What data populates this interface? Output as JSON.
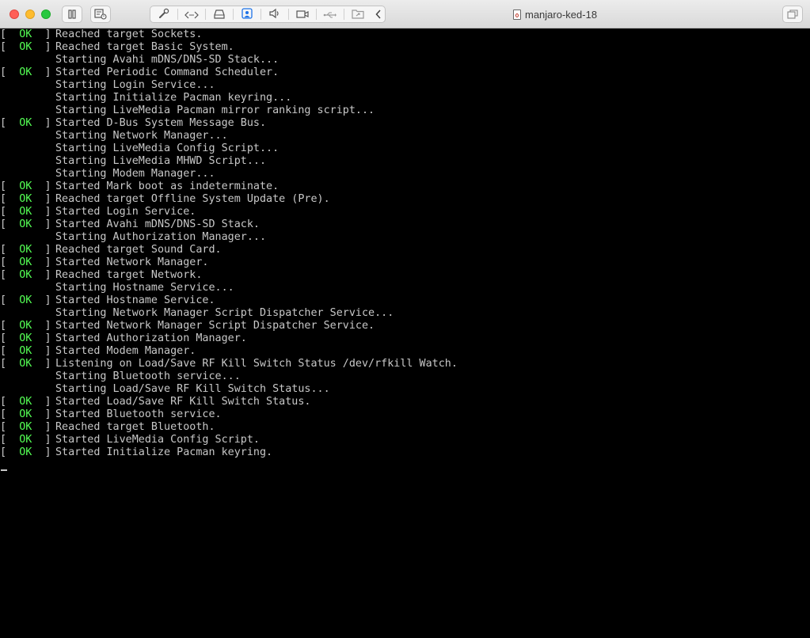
{
  "window": {
    "title": "manjaro-ked-18",
    "toolbar": {
      "pause": "pause-icon",
      "snapshot": "snapshot-icon",
      "settings": "wrench-icon",
      "code": "code-icon",
      "drive": "hard-disk-icon",
      "camera_user": "webcam-user-icon",
      "sound": "speaker-icon",
      "video": "video-camera-icon",
      "usb": "usb-icon",
      "shared_folder": "shared-folder-icon",
      "collapse": "chevron-left-icon",
      "fullscreen": "fullscreen-icon"
    }
  },
  "console": {
    "ok_left": "[",
    "ok_text": "OK",
    "ok_right": "]",
    "lines": [
      {
        "status": "ok",
        "text": "Reached target Sockets."
      },
      {
        "status": "ok",
        "text": "Reached target Basic System."
      },
      {
        "status": "",
        "text": "Starting Avahi mDNS/DNS-SD Stack..."
      },
      {
        "status": "ok",
        "text": "Started Periodic Command Scheduler."
      },
      {
        "status": "",
        "text": "Starting Login Service..."
      },
      {
        "status": "",
        "text": "Starting Initialize Pacman keyring..."
      },
      {
        "status": "",
        "text": "Starting LiveMedia Pacman mirror ranking script..."
      },
      {
        "status": "ok",
        "text": "Started D-Bus System Message Bus."
      },
      {
        "status": "",
        "text": "Starting Network Manager..."
      },
      {
        "status": "",
        "text": "Starting LiveMedia Config Script..."
      },
      {
        "status": "",
        "text": "Starting LiveMedia MHWD Script..."
      },
      {
        "status": "",
        "text": "Starting Modem Manager..."
      },
      {
        "status": "ok",
        "text": "Started Mark boot as indeterminate."
      },
      {
        "status": "ok",
        "text": "Reached target Offline System Update (Pre)."
      },
      {
        "status": "ok",
        "text": "Started Login Service."
      },
      {
        "status": "ok",
        "text": "Started Avahi mDNS/DNS-SD Stack."
      },
      {
        "status": "",
        "text": "Starting Authorization Manager..."
      },
      {
        "status": "ok",
        "text": "Reached target Sound Card."
      },
      {
        "status": "ok",
        "text": "Started Network Manager."
      },
      {
        "status": "ok",
        "text": "Reached target Network."
      },
      {
        "status": "",
        "text": "Starting Hostname Service..."
      },
      {
        "status": "ok",
        "text": "Started Hostname Service."
      },
      {
        "status": "",
        "text": "Starting Network Manager Script Dispatcher Service..."
      },
      {
        "status": "ok",
        "text": "Started Network Manager Script Dispatcher Service."
      },
      {
        "status": "ok",
        "text": "Started Authorization Manager."
      },
      {
        "status": "ok",
        "text": "Started Modem Manager."
      },
      {
        "status": "ok",
        "text": "Listening on Load/Save RF Kill Switch Status /dev/rfkill Watch."
      },
      {
        "status": "",
        "text": "Starting Bluetooth service..."
      },
      {
        "status": "",
        "text": "Starting Load/Save RF Kill Switch Status..."
      },
      {
        "status": "ok",
        "text": "Started Load/Save RF Kill Switch Status."
      },
      {
        "status": "ok",
        "text": "Started Bluetooth service."
      },
      {
        "status": "ok",
        "text": "Reached target Bluetooth."
      },
      {
        "status": "ok",
        "text": "Started LiveMedia Config Script."
      },
      {
        "status": "ok",
        "text": "Started Initialize Pacman keyring."
      }
    ]
  },
  "colors": {
    "ok": "#54ff54",
    "console_text": "#c8c8c8",
    "console_bg": "#000000"
  }
}
